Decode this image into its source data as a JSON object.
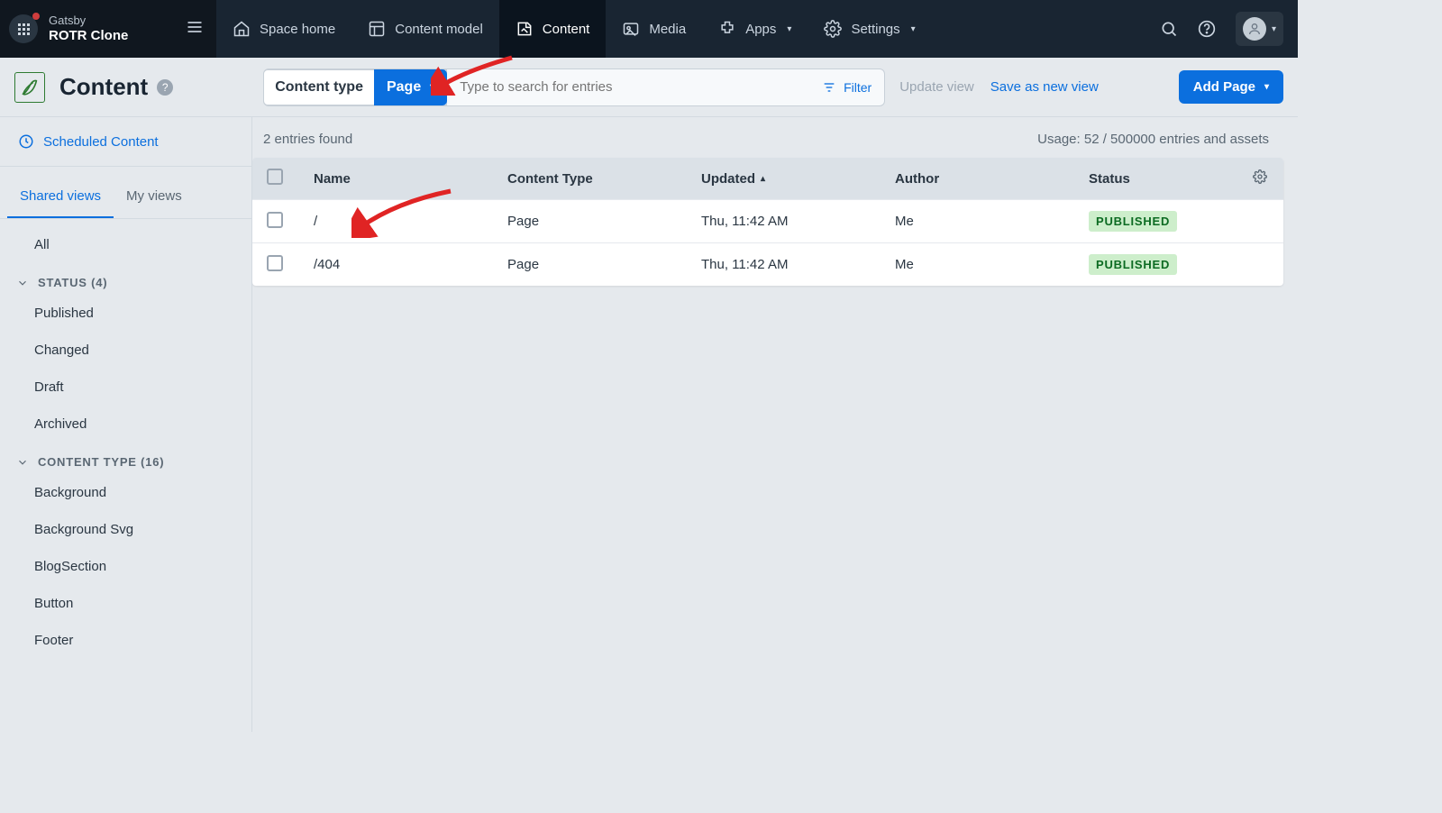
{
  "topbar": {
    "space_line1": "Gatsby",
    "space_line2": "ROTR Clone",
    "nav": {
      "home": "Space home",
      "model": "Content model",
      "content": "Content",
      "media": "Media",
      "apps": "Apps",
      "settings": "Settings"
    }
  },
  "toolbar": {
    "title": "Content",
    "content_type_label": "Content type",
    "content_type_value": "Page",
    "search_placeholder": "Type to search for entries",
    "filter_label": "Filter",
    "update_view": "Update view",
    "save_view": "Save as new view",
    "add_button": "Add Page"
  },
  "sidebar": {
    "scheduled": "Scheduled Content",
    "tabs": {
      "shared": "Shared views",
      "mine": "My views"
    },
    "all": "All",
    "status_group": "STATUS (4)",
    "status_items": [
      "Published",
      "Changed",
      "Draft",
      "Archived"
    ],
    "ct_group": "CONTENT TYPE (16)",
    "ct_items": [
      "Background",
      "Background Svg",
      "BlogSection",
      "Button",
      "Footer"
    ]
  },
  "meta": {
    "count": "2 entries found",
    "usage": "Usage: 52 / 500000 entries and assets"
  },
  "table": {
    "headers": {
      "name": "Name",
      "ct": "Content Type",
      "updated": "Updated",
      "author": "Author",
      "status": "Status"
    },
    "rows": [
      {
        "name": "/",
        "ct": "Page",
        "updated": "Thu, 11:42 AM",
        "author": "Me",
        "status": "PUBLISHED"
      },
      {
        "name": "/404",
        "ct": "Page",
        "updated": "Thu, 11:42 AM",
        "author": "Me",
        "status": "PUBLISHED"
      }
    ]
  }
}
